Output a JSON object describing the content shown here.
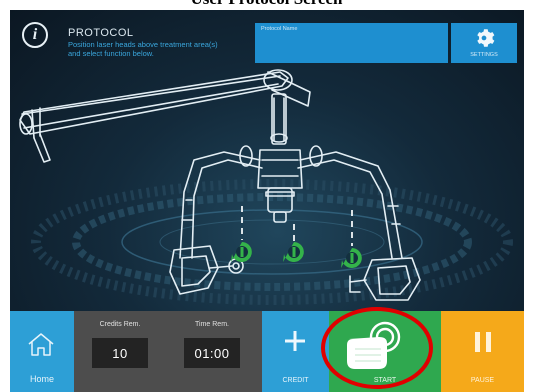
{
  "caption": "User Protocol Screen",
  "header": {
    "title": "PROTOCOL",
    "instructions": "Position laser heads above treatment area(s) and select function below.",
    "protocol_name_label": "Protocol Name",
    "protocol_name_value": "",
    "settings_label": "SETTINGS"
  },
  "bottom_bar": {
    "home_label": "Home",
    "credits_label": "Credits Rem.",
    "credits_value": "10",
    "time_label": "Time Rem.",
    "time_value": "01:00",
    "credit_label": "CREDIT",
    "start_label": "START",
    "pause_label": "PAUSE"
  },
  "colors": {
    "accent_blue": "#1e8fd0",
    "start_green": "#2fa84f",
    "pause_orange": "#f5a91a",
    "counter_gray": "#4d4d4d",
    "marker_green": "#34b34a",
    "highlight_red": "#e00000"
  },
  "icons": [
    "info-icon",
    "gear-icon",
    "home-icon",
    "plus-icon",
    "laser-marker-icon",
    "touch-hand-icon",
    "pause-icon"
  ]
}
